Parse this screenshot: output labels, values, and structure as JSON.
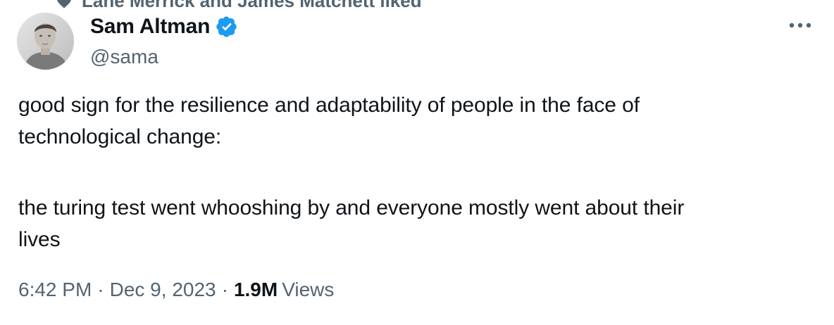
{
  "social_context": {
    "text": "Lane Merrick and James Matchett liked",
    "icon": "heart-icon"
  },
  "author": {
    "display_name": "Sam Altman",
    "handle": "@sama",
    "verified": true,
    "verified_color": "#1d9bf0",
    "avatar_icon": "avatar-photo"
  },
  "more_menu": {
    "icon": "more-horizontal-icon"
  },
  "tweet": {
    "line1": "good sign for the resilience and adaptability of people in the face of",
    "line2": "technological change:",
    "line3": "the turing test went whooshing by and everyone mostly went about their",
    "line4": "lives"
  },
  "meta": {
    "time": "6:42 PM",
    "separator1": "·",
    "date": "Dec 9, 2023",
    "separator2": "·",
    "views_count": "1.9M",
    "views_label": "Views"
  },
  "colors": {
    "text_primary": "#0f1419",
    "text_secondary": "#536471",
    "accent": "#1d9bf0"
  }
}
